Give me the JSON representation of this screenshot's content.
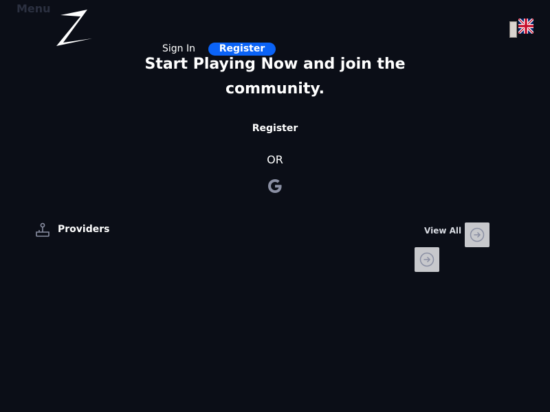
{
  "header": {
    "menu_label": "Menu",
    "logo_icon": "z-logo-icon",
    "language_flag_icon": "uk-flag-icon",
    "sign_in_label": "Sign In",
    "register_label": "Register"
  },
  "hero": {
    "headline": "Start Playing Now and join the community.",
    "register_label": "Register",
    "or_label": "OR",
    "google_icon": "google-icon"
  },
  "providers": {
    "icon": "joystick-icon",
    "title": "Providers",
    "view_all_label": "View All",
    "arrow_icon": "arrow-right-circle-icon"
  },
  "colors": {
    "background": "#0b0e17",
    "accent": "#0b63f6",
    "button_gray": "#c7c8cc",
    "icon_gray": "#8a8fa3"
  }
}
